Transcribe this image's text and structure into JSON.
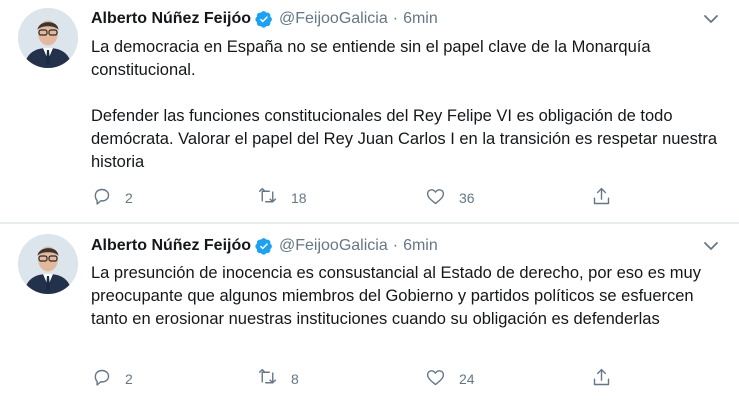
{
  "tweets": [
    {
      "author_name": "Alberto Núñez Feijóo",
      "handle": "@FeijooGalicia",
      "separator": "·",
      "time": "6min",
      "paragraphs": [
        "La democracia en España no se entiende sin el papel clave de la Monarquía constitucional.",
        "Defender las funciones constitucionales del Rey Felipe VI es obligación de todo demócrata. Valorar el papel del Rey Juan Carlos I en la transición es respetar nuestra historia"
      ],
      "replies": "2",
      "retweets": "18",
      "likes": "36"
    },
    {
      "author_name": "Alberto Núñez Feijóo",
      "handle": "@FeijooGalicia",
      "separator": "·",
      "time": "6min",
      "paragraphs": [
        "La presunción de inocencia es consustancial al Estado de derecho, por eso es muy preocupante que algunos miembros del Gobierno y partidos políticos se esfuercen tanto en erosionar nuestras instituciones cuando su obligación es defenderlas"
      ],
      "replies": "2",
      "retweets": "8",
      "likes": "24"
    }
  ],
  "colors": {
    "verified_badge": "#1da1f2",
    "muted_text": "#657786",
    "thread_line": "#ccd6dd",
    "separator": "#e6ecf0"
  },
  "icons": [
    "verified-badge-icon",
    "chevron-down-icon",
    "reply-icon",
    "retweet-icon",
    "like-icon",
    "share-icon"
  ]
}
